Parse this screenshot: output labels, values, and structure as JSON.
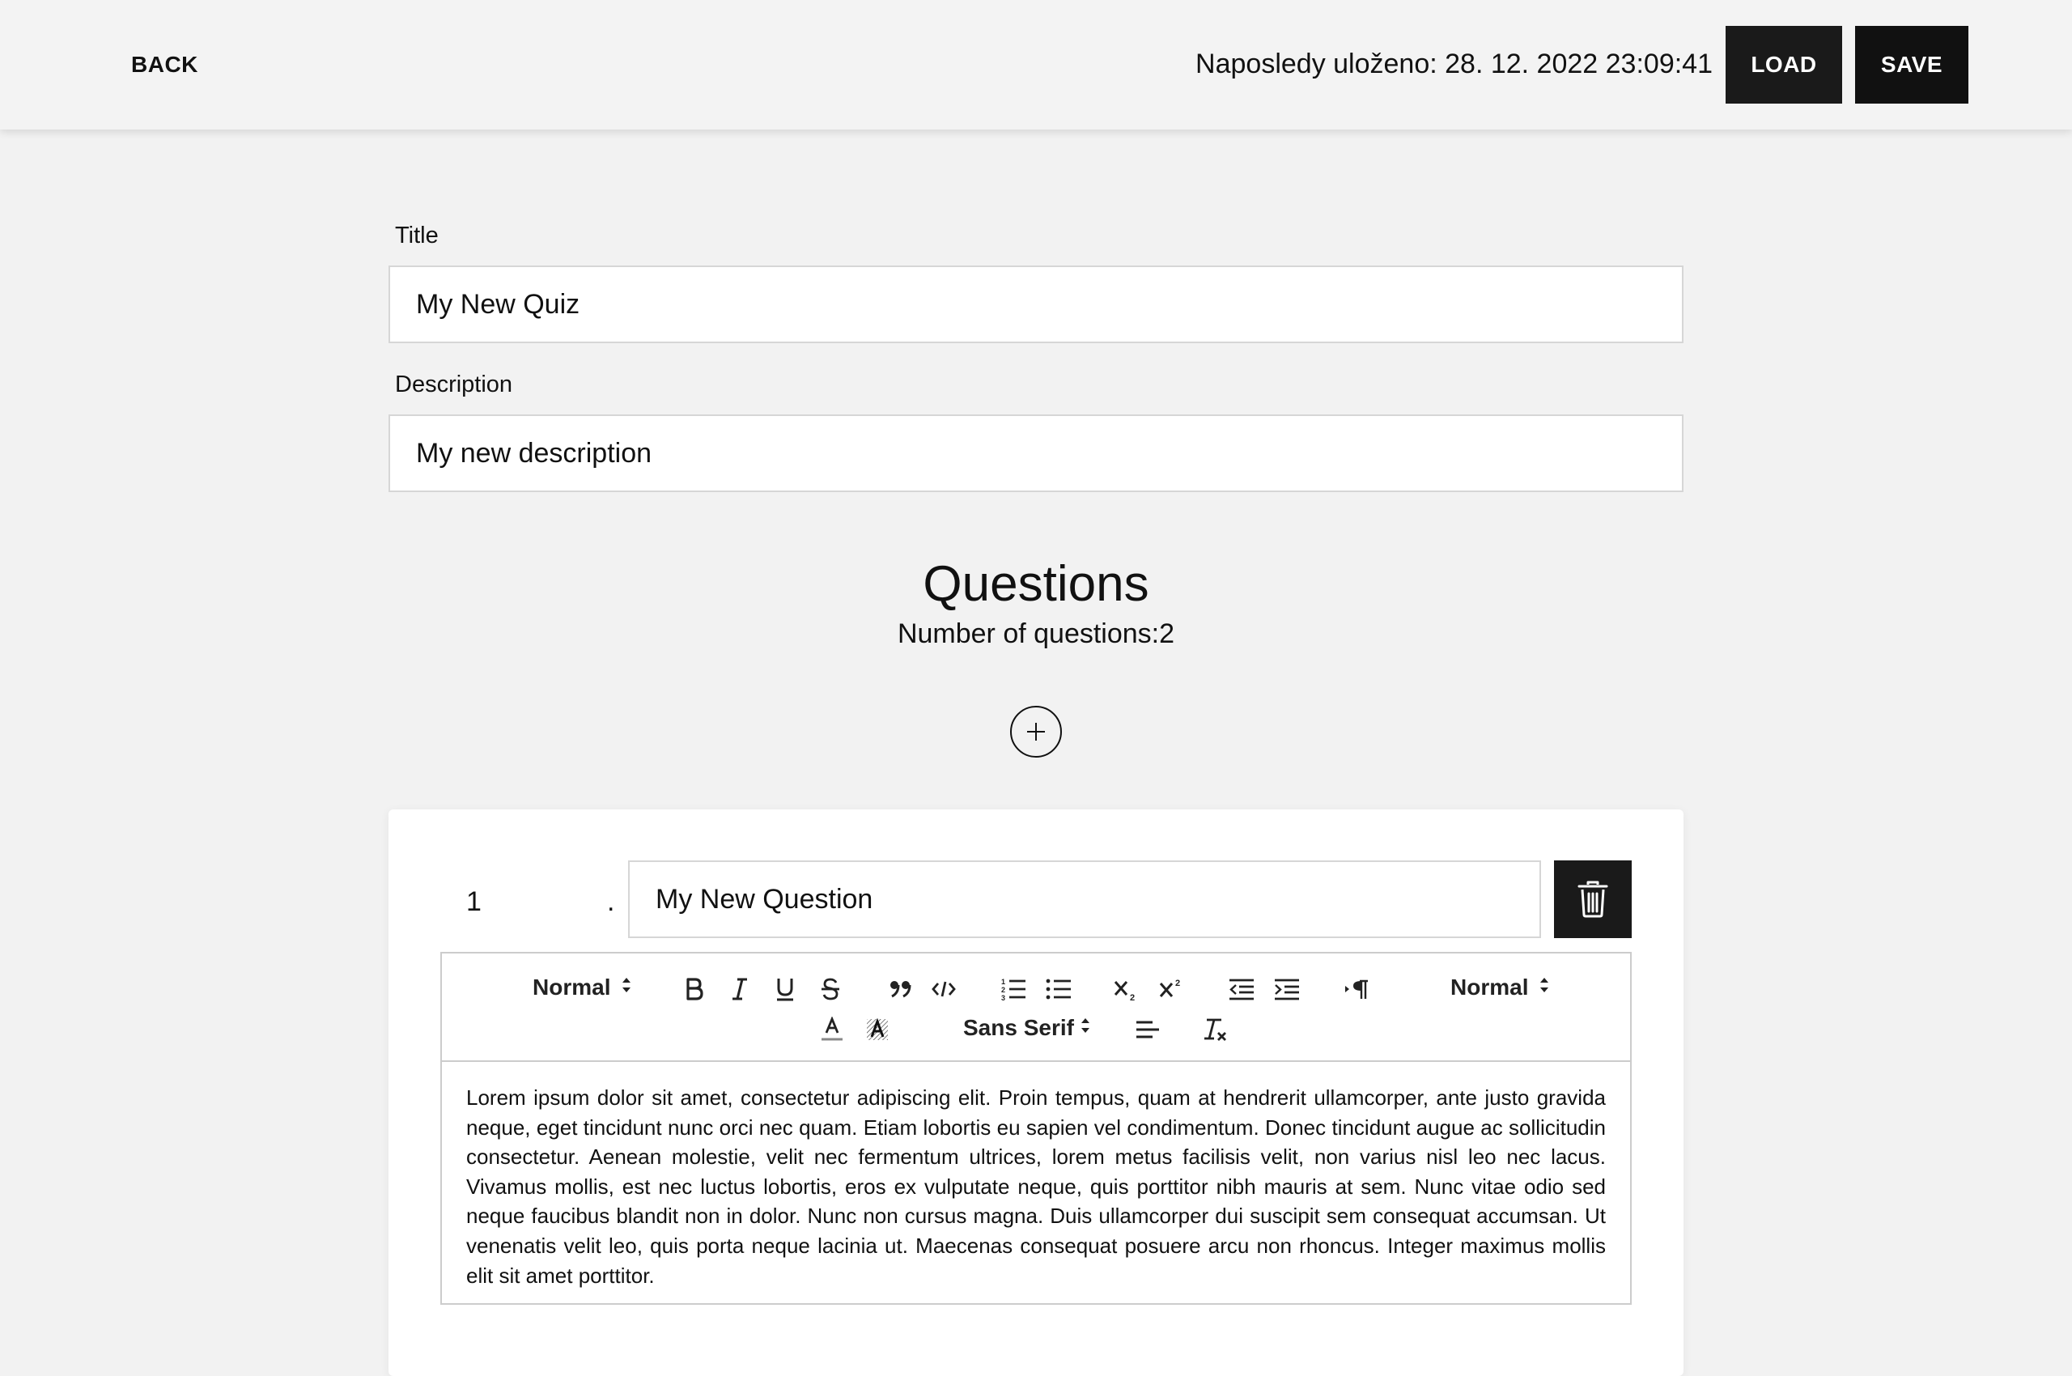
{
  "header": {
    "back_label": "BACK",
    "last_saved": "Naposledy uloženo: 28. 12. 2022 23:09:41",
    "load_label": "LOAD",
    "save_label": "SAVE"
  },
  "form": {
    "title_label": "Title",
    "title_value": "My New Quiz",
    "description_label": "Description",
    "description_value": "My new description"
  },
  "questions": {
    "heading": "Questions",
    "count_text": "Number of questions:2",
    "items": [
      {
        "number": "1",
        "dot": ".",
        "title": "My New Question",
        "body": "Lorem ipsum dolor sit amet, consectetur adipiscing elit. Proin tempus, quam at hendrerit ullamcorper, ante justo gravida neque, eget tincidunt nunc orci nec quam. Etiam lobortis eu sapien vel condimentum. Donec tincidunt augue ac sollicitudin consectetur. Aenean molestie, velit nec fermentum ultrices, lorem metus facilisis velit, non varius nisl leo nec lacus. Vivamus mollis, est nec luctus lobortis, eros ex vulputate neque, quis porttitor nibh mauris at sem. Nunc vitae odio sed neque faucibus blandit non in dolor. Nunc non cursus magna. Duis ullamcorper dui suscipit sem consequat accumsan. Ut venenatis velit leo, quis porta neque lacinia ut. Maecenas consequat posuere arcu non rhoncus. Integer maximus mollis elit sit amet porttitor."
      }
    ]
  },
  "toolbar": {
    "header_select": "Normal",
    "size_select": "Normal",
    "font_select": "Sans Serif",
    "icons": [
      "bold-icon",
      "italic-icon",
      "underline-icon",
      "strike-icon",
      "blockquote-icon",
      "code-block-icon",
      "ordered-list-icon",
      "bullet-list-icon",
      "subscript-icon",
      "superscript-icon",
      "outdent-icon",
      "indent-icon",
      "rtl-icon",
      "text-color-icon",
      "background-color-icon",
      "align-icon",
      "clean-icon"
    ]
  }
}
